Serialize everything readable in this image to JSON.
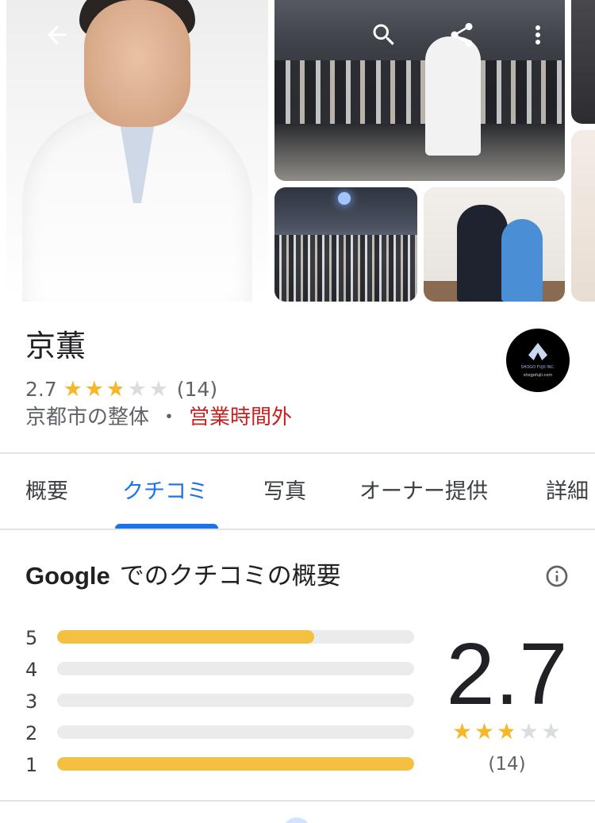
{
  "place": {
    "name": "京薫",
    "rating": "2.7",
    "rating_value": 2.7,
    "review_count": "(14)",
    "category": "京都市の整体",
    "separator": "・",
    "status": "営業時間外",
    "logo_text_1": "SHOGO FUJII INC.",
    "logo_text_2": "shogofujii.com"
  },
  "icons": {
    "back": "arrow-back-icon",
    "search": "search-icon",
    "share": "share-icon",
    "more": "more-vert-icon",
    "info": "info-icon"
  },
  "tabs": [
    {
      "label": "概要"
    },
    {
      "label": "クチコミ"
    },
    {
      "label": "写真"
    },
    {
      "label": "オーナー提供"
    },
    {
      "label": "詳細"
    }
  ],
  "summary": {
    "title_brand": "Google",
    "title_rest": "でのクチコミの概要",
    "score": "2.7",
    "score_value": 2.7,
    "count": "(14)",
    "distribution": [
      {
        "stars": "5",
        "fraction": 0.72
      },
      {
        "stars": "4",
        "fraction": 0.0
      },
      {
        "stars": "3",
        "fraction": 0.0
      },
      {
        "stars": "2",
        "fraction": 0.0
      },
      {
        "stars": "1",
        "fraction": 1.0
      }
    ]
  },
  "colors": {
    "accent": "#1a73e8",
    "star": "#f6b826",
    "bar": "#f4c041",
    "closed": "#c5221f"
  }
}
